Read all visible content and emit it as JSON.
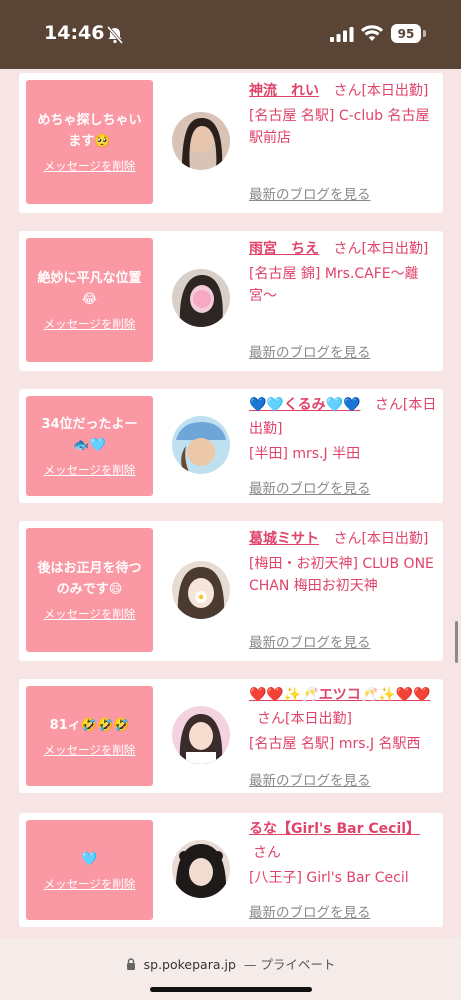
{
  "status_bar": {
    "time": "14:46",
    "battery": "95"
  },
  "cards": [
    {
      "message": "めちゃ探しちゃいます🥺",
      "delete_label": "メッセージを削除",
      "name": "神流　れい",
      "suffix": "さん[本日出勤]",
      "shop": "[名古屋 名駅] C-club 名古屋駅前店",
      "blog_label": "最新のブログを見る",
      "avatar_colors": [
        "#3a2a22",
        "#c9a08a"
      ]
    },
    {
      "message": "絶妙に平凡な位置😂",
      "delete_label": "メッセージを削除",
      "name": "雨宮　ちえ",
      "suffix": "さん[本日出勤]",
      "shop": "[名古屋 錦] Mrs.CAFE〜離宮〜",
      "blog_label": "最新のブログを見る",
      "avatar_colors": [
        "#2e2622",
        "#f3b8cc"
      ]
    },
    {
      "message": "34位だったよー🐟🩵",
      "delete_label": "メッセージを削除",
      "name": "💙🩵くるみ🩵💙",
      "suffix": "さん[本日出勤]",
      "shop": "[半田] mrs.J 半田",
      "blog_label": "最新のブログを見る",
      "avatar_colors": [
        "#6fa6d8",
        "#e9c9a6"
      ]
    },
    {
      "message": "後はお正月を待つのみです😄",
      "delete_label": "メッセージを削除",
      "name": "葛城ミサト",
      "suffix": "さん[本日出勤]",
      "shop": "[梅田・お初天神] CLUB ONE CHAN 梅田お初天神",
      "blog_label": "最新のブログを見る",
      "avatar_colors": [
        "#4a3a30",
        "#f0e6de"
      ]
    },
    {
      "message": "81ィ🤣🤣🤣",
      "delete_label": "メッセージを削除",
      "name": "❤️❤️✨🥂エツコ🥂✨❤️❤️",
      "suffix": "さん[本日出勤]",
      "shop": "[名古屋 名駅] mrs.J 名駅西",
      "blog_label": "最新のブログを見る",
      "avatar_colors": [
        "#f3d3e0",
        "#e8b9c7"
      ]
    },
    {
      "message": "🩵",
      "delete_label": "メッセージを削除",
      "name": "るな【Girl's Bar Cecil】",
      "suffix": "さん",
      "shop": "[八王子] Girl's Bar Cecil",
      "blog_label": "最新のブログを見る",
      "avatar_colors": [
        "#1f1a1a",
        "#ead6cf"
      ]
    }
  ],
  "address_bar": {
    "domain": "sp.pokepara.jp",
    "mode": "— プライベート"
  }
}
